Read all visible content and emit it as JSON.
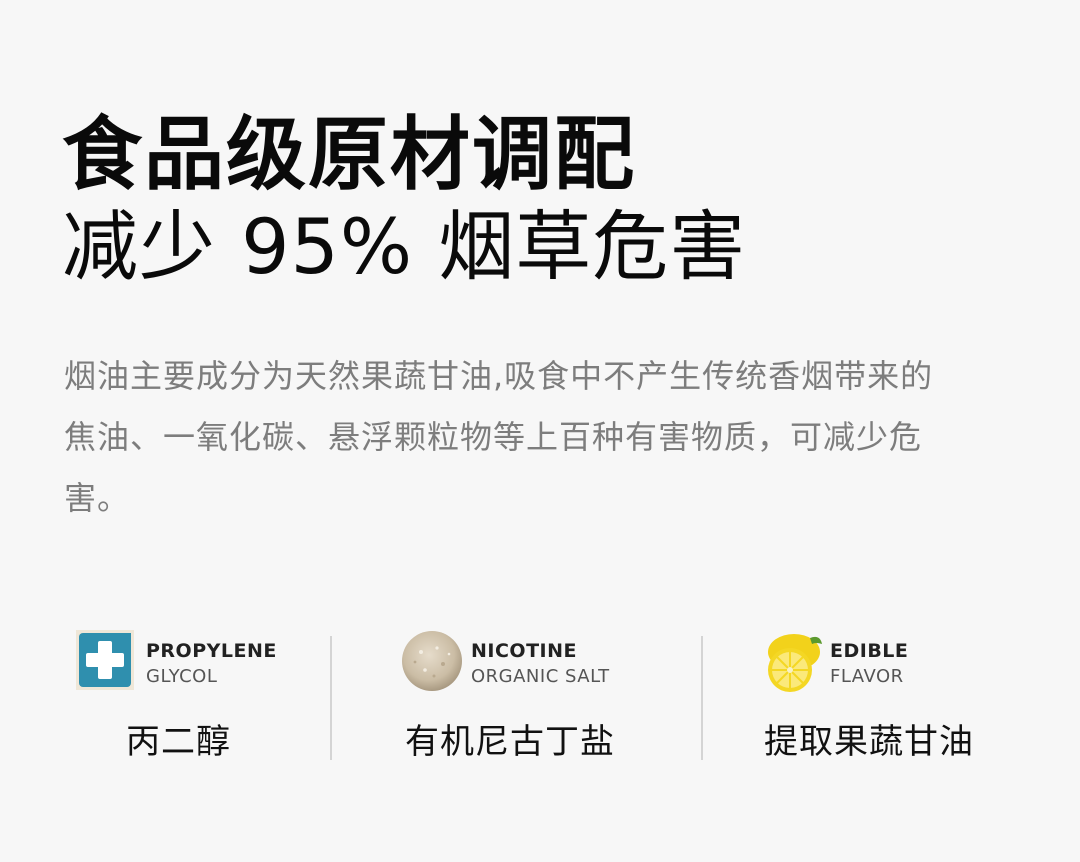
{
  "headline": "食品级原材调配",
  "subline": "减少 95% 烟草危害",
  "description": "烟油主要成分为天然果蔬甘油,吸食中不产生传统香烟带来的焦油、一氧化碳、悬浮颗粒物等上百种有害物质，可减少危害。",
  "features": [
    {
      "icon": "medical-cross-icon",
      "en_line1": "PROPYLENE",
      "en_line2": "GLYCOL",
      "cn_label": "丙二醇"
    },
    {
      "icon": "salt-crystal-icon",
      "en_line1": "NICOTINE",
      "en_line2": "ORGANIC SALT",
      "cn_label": "有机尼古丁盐"
    },
    {
      "icon": "lemon-icon",
      "en_line1": "EDIBLE",
      "en_line2": "FLAVOR",
      "cn_label": "提取果蔬甘油"
    }
  ],
  "colors": {
    "background": "#f7f7f7",
    "headline": "#0a0a0a",
    "body_text": "#7d7d7d",
    "cross_blue": "#2f8fae",
    "lemon_yellow": "#f2d21b"
  }
}
